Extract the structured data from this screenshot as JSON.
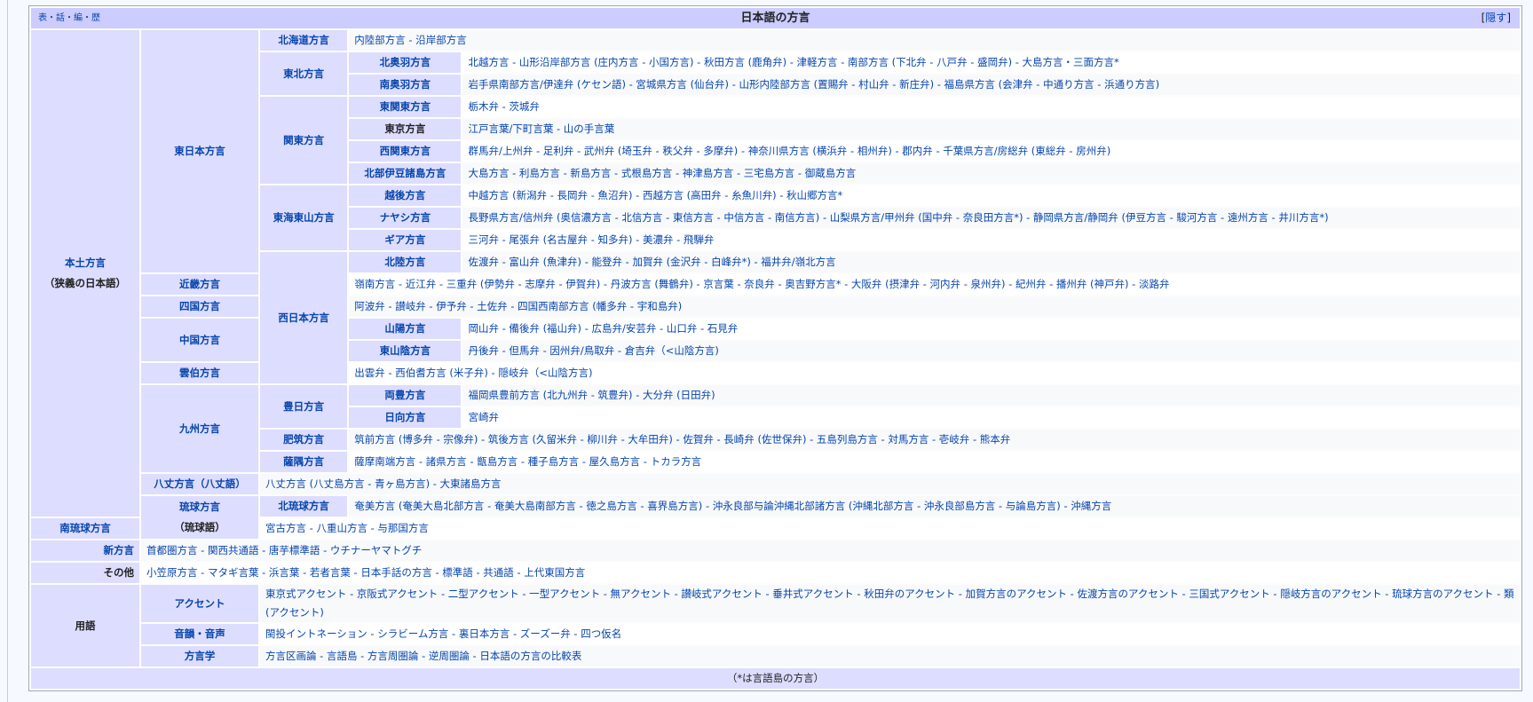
{
  "navbox": {
    "vte": "表・話・編・歴",
    "title": "日本語の方言",
    "hide_prefix": "[",
    "hide_label": "隠す",
    "hide_suffix": "]",
    "groups": {
      "honshu": "本土方言",
      "honshu_note": "（狭義の日本語）",
      "east": "東日本方言",
      "west": "西日本方言",
      "kyushu": "九州方言",
      "hachijo": "八丈方言（八丈語）",
      "ryukyu": "琉球方言",
      "ryukyu_note": "（琉球語）",
      "new": "新方言",
      "other": "その他",
      "terms": "用語"
    },
    "rows": {
      "hokkaido": {
        "label": "北海道方言",
        "text": "内陸部方言 - 沿岸部方言"
      },
      "tohoku": "東北方言",
      "kitaou": {
        "label": "北奥羽方言",
        "text": "北越方言 - 山形沿岸部方言 (庄内方言 - 小国方言) - 秋田方言 (鹿角弁) - 津軽方言 - 南部方言 (下北弁 - 八戸弁 - 盛岡弁) - 大島方言・三面方言*"
      },
      "minamiou": {
        "label": "南奥羽方言",
        "text": "岩手県南部方言/伊達弁 (ケセン語) - 宮城県方言 (仙台弁) - 山形内陸部方言 (置賜弁 - 村山弁 - 新庄弁) - 福島県方言 (会津弁 - 中通り方言 - 浜通り方言)"
      },
      "kanto": "関東方言",
      "higashikanto": {
        "label": "東関東方言",
        "text": "栃木弁 - 茨城弁"
      },
      "tokyo": {
        "label": "東京方言",
        "text": "江戸言葉/下町言葉 - 山の手言葉"
      },
      "nishikanto": {
        "label": "西関東方言",
        "text": "群馬弁/上州弁 - 足利弁 - 武州弁 (埼玉弁 - 秩父弁 - 多摩弁) - 神奈川県方言 (横浜弁 - 相州弁) - 郡内弁 - 千葉県方言/房総弁 (東総弁 - 房州弁)"
      },
      "izu": {
        "label": "北部伊豆諸島方言",
        "text": "大島方言 - 利島方言 - 新島方言 - 式根島方言 - 神津島方言 - 三宅島方言 - 御蔵島方言"
      },
      "tokai": "東海東山方言",
      "echigo": {
        "label": "越後方言",
        "text": "中越方言 (新潟弁 - 長岡弁 - 魚沼弁) - 西越方言 (高田弁 - 糸魚川弁) - 秋山郷方言*"
      },
      "nayashi": {
        "label": "ナヤシ方言",
        "text": "長野県方言/信州弁 (奥信濃方言 - 北信方言 - 東信方言 - 中信方言 - 南信方言) - 山梨県方言/甲州弁 (国中弁 - 奈良田方言*) - 静岡県方言/静岡弁 (伊豆方言 - 駿河方言 - 遠州方言 - 井川方言*)"
      },
      "gia": {
        "label": "ギア方言",
        "text": "三河弁 - 尾張弁 (名古屋弁 - 知多弁) - 美濃弁 - 飛騨弁"
      },
      "hokuriku": {
        "label": "北陸方言",
        "text": "佐渡弁 - 富山弁 (魚津弁) - 能登弁 - 加賀弁 (金沢弁 - 白峰弁*) - 福井弁/嶺北方言"
      },
      "kinki": {
        "label": "近畿方言",
        "text": "嶺南方言 - 近江弁 - 三重弁 (伊勢弁 - 志摩弁 - 伊賀弁) - 丹波方言 (舞鶴弁) - 京言葉 - 奈良弁 - 奥吉野方言* - 大阪弁 (摂津弁 - 河内弁 - 泉州弁) - 紀州弁 - 播州弁 (神戸弁) - 淡路弁"
      },
      "shikoku": {
        "label": "四国方言",
        "text": "阿波弁 - 讃岐弁 - 伊予弁 - 土佐弁 - 四国西南部方言 (幡多弁 - 宇和島弁)"
      },
      "chugoku": "中国方言",
      "sanyo": {
        "label": "山陽方言",
        "text": "岡山弁 - 備後弁 (福山弁) - 広島弁/安芸弁 - 山口弁 - 石見弁"
      },
      "tosan": {
        "label": "東山陰方言",
        "text": "丹後弁 - 但馬弁 - 因州弁/鳥取弁 - 倉吉弁（<山陰方言)"
      },
      "unpaku": {
        "label": "雲伯方言",
        "text": "出雲弁 - 西伯耆方言 (米子弁) - 隠岐弁（<山陰方言)"
      },
      "hohi": "豊日方言",
      "ryobu": {
        "label": "両豊方言",
        "text": "福岡県豊前方言 (北九州弁 - 筑豊弁) - 大分弁 (日田弁)"
      },
      "hyuga": {
        "label": "日向方言",
        "text": "宮崎弁"
      },
      "hichiku": {
        "label": "肥筑方言",
        "text": "筑前方言 (博多弁 - 宗像弁) - 筑後方言 (久留米弁 - 柳川弁 - 大牟田弁) - 佐賀弁 - 長崎弁 (佐世保弁) - 五島列島方言 - 対馬方言 - 壱岐弁 - 熊本弁"
      },
      "satsugu": {
        "label": "薩隅方言",
        "text": "薩摩南端方言 - 諸県方言 - 甑島方言 - 種子島方言 - 屋久島方言 - トカラ方言"
      },
      "hachijo_text": "八丈方言 (八丈島方言 - 青ヶ島方言) - 大東諸島方言",
      "kitaryukyu": {
        "label": "北琉球方言",
        "text": "奄美方言 (奄美大島北部方言 - 奄美大島南部方言 - 徳之島方言 - 喜界島方言) - 沖永良部与論沖縄北部諸方言 (沖縄北部方言 - 沖永良部島方言 - 与論島方言) - 沖縄方言"
      },
      "minamiryukyu": {
        "label": "南琉球方言",
        "text": "宮古方言 - 八重山方言 - 与那国方言"
      },
      "new_text": "首都圏方言 - 関西共通語 - 唐芋標準語 - ウチナーヤマトグチ",
      "other_text": "小笠原方言 - マタギ言葉 - 浜言葉 - 若者言葉 - 日本手話の方言 - 標準語 - 共通語 - 上代東国方言",
      "accent": {
        "label": "アクセント",
        "text": "東京式アクセント - 京阪式アクセント - 二型アクセント - 一型アクセント - 無アクセント - 讃岐式アクセント - 垂井式アクセント - 秋田弁のアクセント - 加賀方言のアクセント - 佐渡方言のアクセント - 三国式アクセント - 隠岐方言のアクセント - 琉球方言のアクセント - 類 (アクセント)"
      },
      "phon": {
        "label": "音韻・音声",
        "text": "閩投イントネーション - シラビーム方言 - 裏日本方言 - ズーズー弁 - 四つ仮名"
      },
      "dialectology": {
        "label": "方言学",
        "text": "方言区画論 - 言語島 - 方言周圏論 - 逆周圏論 - 日本語の方言の比較表"
      }
    },
    "below": "（*は言語島の方言）"
  },
  "colors": {
    "title_bg": "#ccccff",
    "group_bg": "#ddddff",
    "list_bg": "#f8f9fa",
    "link": "#0645ad"
  }
}
